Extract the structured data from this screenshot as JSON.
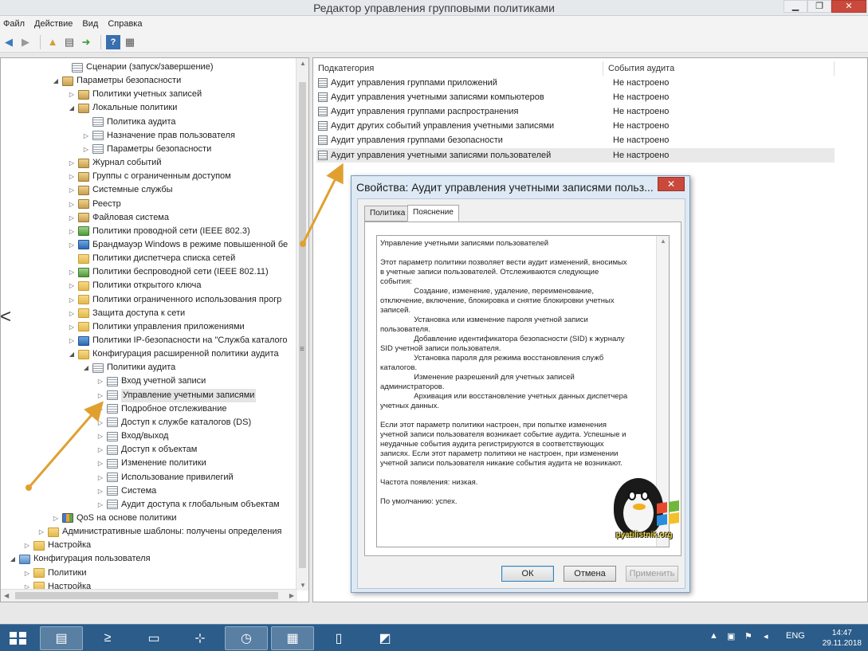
{
  "window": {
    "title": "Редактор управления групповыми политиками",
    "min": "▁",
    "max": "❐",
    "close": "✕"
  },
  "menu": [
    "Файл",
    "Действие",
    "Вид",
    "Справка"
  ],
  "tree": [
    {
      "label": "Сценарии (запуск/завершение)",
      "exp": "",
      "icon": "policy"
    },
    {
      "label": "Параметры безопасности",
      "exp": "◢",
      "icon": "lock"
    },
    {
      "label": "Политики учетных записей",
      "exp": "▷",
      "icon": "lock"
    },
    {
      "label": "Локальные политики",
      "exp": "◢",
      "icon": "lock"
    },
    {
      "label": "Политика аудита",
      "exp": "",
      "icon": "policy"
    },
    {
      "label": "Назначение прав пользователя",
      "exp": "▷",
      "icon": "policy"
    },
    {
      "label": "Параметры безопасности",
      "exp": "▷",
      "icon": "policy"
    },
    {
      "label": "Журнал событий",
      "exp": "▷",
      "icon": "lock"
    },
    {
      "label": "Группы с ограниченным доступом",
      "exp": "▷",
      "icon": "lock"
    },
    {
      "label": "Системные службы",
      "exp": "▷",
      "icon": "lock"
    },
    {
      "label": "Реестр",
      "exp": "▷",
      "icon": "lock"
    },
    {
      "label": "Файловая система",
      "exp": "▷",
      "icon": "lock"
    },
    {
      "label": "Политики проводной сети (IEEE 802.3)",
      "exp": "▷",
      "icon": "net"
    },
    {
      "label": "Брандмауэр Windows в режиме повышенной бе",
      "exp": "▷",
      "icon": "shield"
    },
    {
      "label": "Политики диспетчера списка сетей",
      "exp": "",
      "icon": "folder"
    },
    {
      "label": "Политики беспроводной сети (IEEE 802.11)",
      "exp": "▷",
      "icon": "net"
    },
    {
      "label": "Политики открытого ключа",
      "exp": "▷",
      "icon": "folder"
    },
    {
      "label": "Политики ограниченного использования прогр",
      "exp": "▷",
      "icon": "folder"
    },
    {
      "label": "Защита доступа к сети",
      "exp": "▷",
      "icon": "folder"
    },
    {
      "label": "Политики управления приложениями",
      "exp": "▷",
      "icon": "folder"
    },
    {
      "label": "Политики IP-безопасности на \"Служба каталого",
      "exp": "▷",
      "icon": "shield"
    },
    {
      "label": "Конфигурация расширенной политики аудита",
      "exp": "◢",
      "icon": "folder"
    },
    {
      "label": "Политики аудита",
      "exp": "◢",
      "icon": "policy"
    },
    {
      "label": "Вход учетной записи",
      "exp": "▷",
      "icon": "policy"
    },
    {
      "label": "Управление учетными записями",
      "exp": "▷",
      "icon": "policy",
      "selected": true
    },
    {
      "label": "Подробное отслеживание",
      "exp": "▷",
      "icon": "policy"
    },
    {
      "label": "Доступ к службе каталогов (DS)",
      "exp": "▷",
      "icon": "policy"
    },
    {
      "label": "Вход/выход",
      "exp": "▷",
      "icon": "policy"
    },
    {
      "label": "Доступ к объектам",
      "exp": "▷",
      "icon": "policy"
    },
    {
      "label": "Изменение политики",
      "exp": "▷",
      "icon": "policy"
    },
    {
      "label": "Использование привилегий",
      "exp": "▷",
      "icon": "policy"
    },
    {
      "label": "Система",
      "exp": "▷",
      "icon": "policy"
    },
    {
      "label": "Аудит доступа к глобальным объектам",
      "exp": "▷",
      "icon": "policy"
    },
    {
      "label": "QoS на основе политики",
      "exp": "▷",
      "icon": "chart"
    },
    {
      "label": "Административные шаблоны: получены определения",
      "exp": "▷",
      "icon": "folder"
    },
    {
      "label": "Настройка",
      "exp": "▷",
      "icon": "folder"
    },
    {
      "label": "Конфигурация пользователя",
      "exp": "◢",
      "icon": "monitor"
    },
    {
      "label": "Политики",
      "exp": "▷",
      "icon": "folder"
    },
    {
      "label": "Настройка",
      "exp": "▷",
      "icon": "folder"
    }
  ],
  "list": {
    "col1": "Подкатегория",
    "col2": "События аудита",
    "rows": [
      {
        "name": "Аудит управления группами приложений",
        "value": "Не настроено"
      },
      {
        "name": "Аудит управления учетными записями компьютеров",
        "value": "Не настроено"
      },
      {
        "name": "Аудит управления группами распространения",
        "value": "Не настроено"
      },
      {
        "name": "Аудит других событий управления учетными записями",
        "value": "Не настроено"
      },
      {
        "name": "Аудит управления группами безопасности",
        "value": "Не настроено"
      },
      {
        "name": "Аудит управления учетными записями пользователей",
        "value": "Не настроено",
        "selected": true
      }
    ]
  },
  "dialog": {
    "title": "Свойства: Аудит управления учетными записями польз...",
    "close": "✕",
    "tab_policy": "Политика",
    "tab_explain": "Пояснение",
    "text": "Управление учетными записями пользователей\n\nЭтот параметр политики позволяет вести аудит изменений, вносимых\nв учетные записи пользователей. Отслеживаются следующие\nсобытия:\n                Создание, изменение, удаление, переименование,\nотключение, включение, блокировка и снятие блокировки учетных\nзаписей.\n                Установка или изменение пароля учетной записи\nпользователя.\n                Добавление идентификатора безопасности (SID) к журналу\nSID учетной записи пользователя.\n                Установка пароля для режима восстановления служб\nкаталогов.\n                Изменение разрешений для учетных записей\nадминистраторов.\n                Архивация или восстановление учетных данных диспетчера\nучетных данных.\n\nЕсли этот параметр политики настроен, при попытке изменения\nучетной записи пользователя возникает событие аудита. Успешные и\nнеудачные события аудита регистрируются в соответствующих\nзаписях. Если этот параметр политики не настроен, при изменении\nучетной записи пользователя никакие события аудита не возникают.\n\nЧастота появления: низкая.\n\nПо умолчанию: успех.",
    "ok": "ОК",
    "cancel": "Отмена",
    "apply": "Применить"
  },
  "watermark": {
    "caption": "pyatilistnik.org"
  },
  "taskbar": {
    "lang": "ENG",
    "time": "14:47",
    "date": "29.11.2018"
  }
}
